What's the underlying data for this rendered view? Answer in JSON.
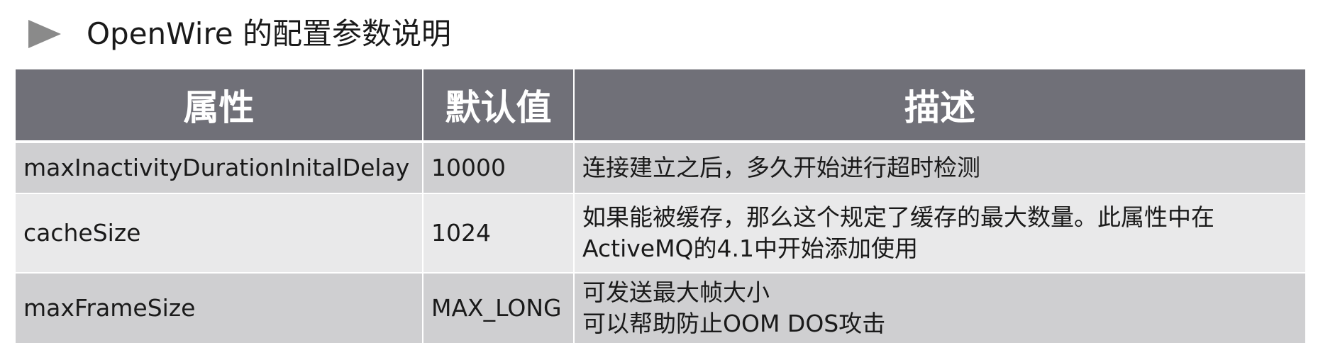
{
  "title": "OpenWire 的配置参数说明",
  "table": {
    "headers": [
      "属性",
      "默认值",
      "描述"
    ],
    "rows": [
      {
        "property": "maxInactivityDurationInitalDelay",
        "default": "10000",
        "description": [
          "连接建立之后，多久开始进行超时检测"
        ]
      },
      {
        "property": "cacheSize",
        "default": "1024",
        "description": [
          "如果能被缓存，那么这个规定了缓存的最大数量。此属性中在",
          "ActiveMQ的4.1中开始添加使用"
        ]
      },
      {
        "property": "maxFrameSize",
        "default": "MAX_LONG",
        "description": [
          "可发送最大帧大小",
          "可以帮助防止OOM DOS攻击"
        ]
      }
    ]
  },
  "colors": {
    "header_bg": "#707078",
    "row_dark": "#cfcfd1",
    "row_light": "#e9e9ea",
    "bullet": "#8a8a8a"
  },
  "icons": {
    "bullet": "play-triangle-icon"
  }
}
